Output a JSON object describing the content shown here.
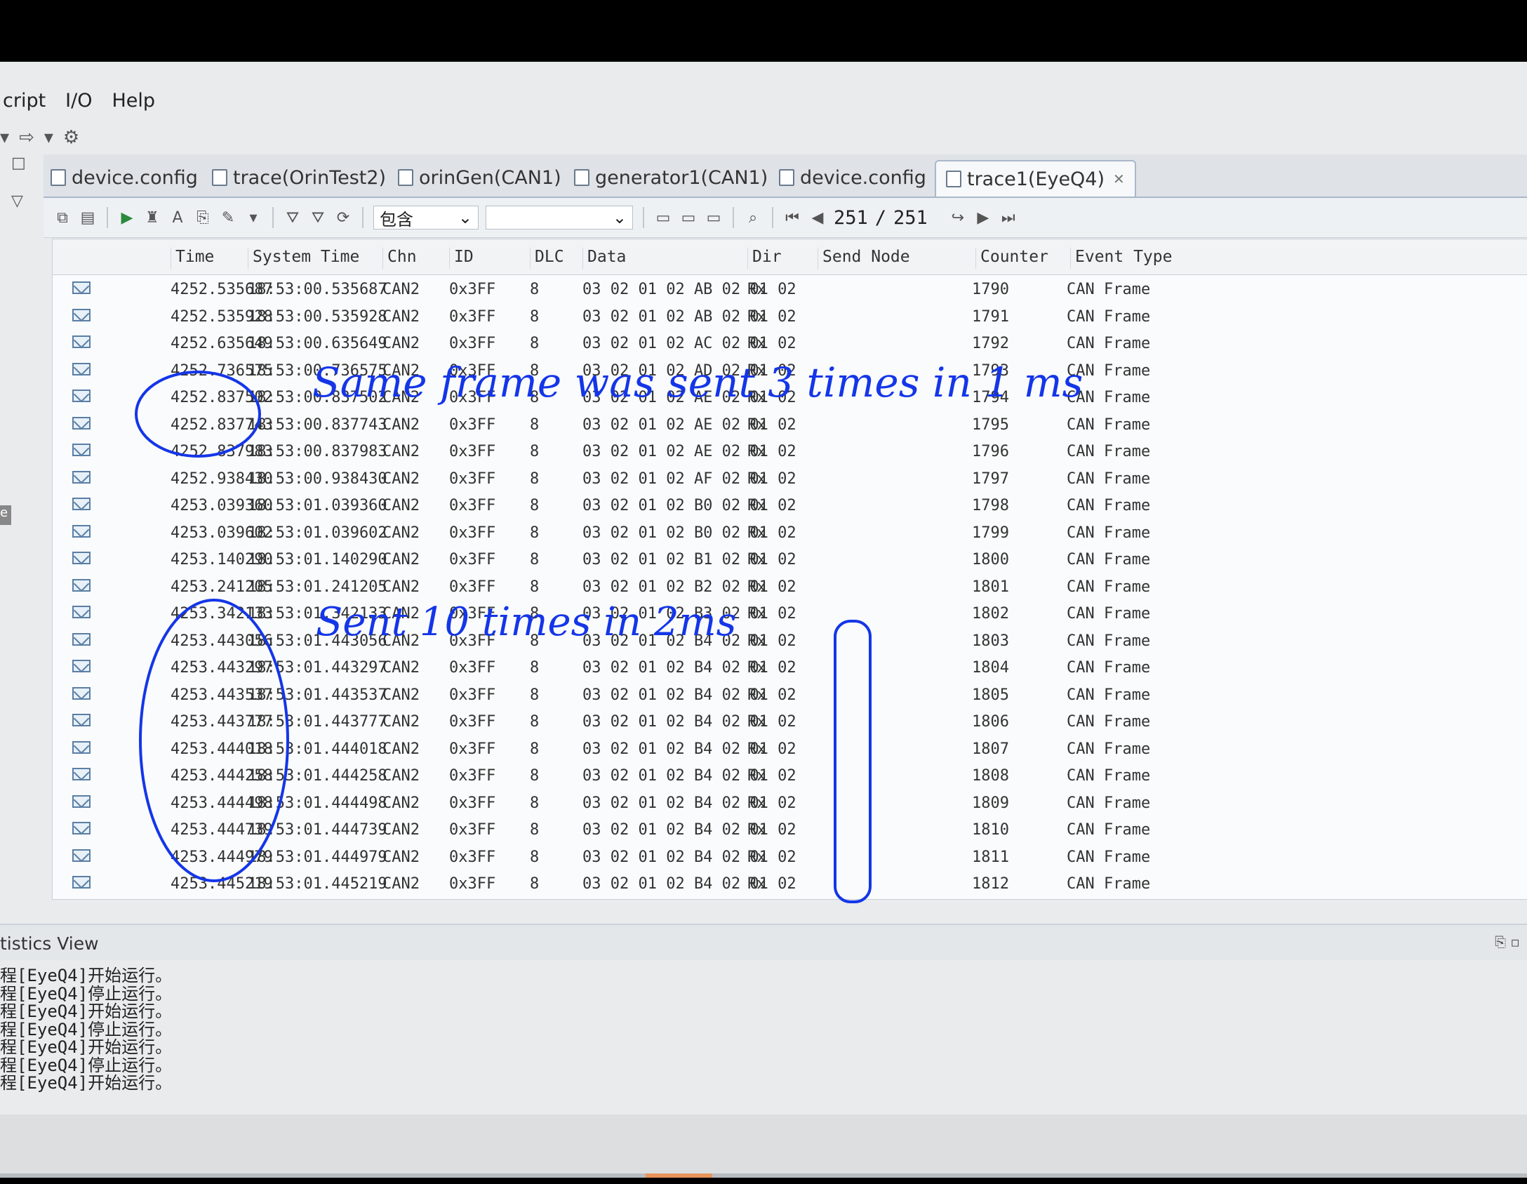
{
  "menu": {
    "items": [
      "cript",
      "I/O",
      "Help"
    ]
  },
  "tabs": [
    {
      "label": "device.config"
    },
    {
      "label": "trace(OrinTest2)"
    },
    {
      "label": "orinGen(CAN1)"
    },
    {
      "label": "generator1(CAN1)"
    },
    {
      "label": "device.config"
    },
    {
      "label": "trace1(EyeQ4)"
    }
  ],
  "toolbar": {
    "filter_mode": "包含",
    "page_current": "251",
    "page_separator": "/",
    "page_total": "251"
  },
  "columns": [
    "Time",
    "System Time",
    "Chn",
    "ID",
    "DLC",
    "Data",
    "Dir",
    "Send Node",
    "Counter",
    "Event Type"
  ],
  "rows": [
    [
      "4252.535687",
      "18:53:00.535687",
      "CAN2",
      "0x3FF",
      "8",
      "03 02 01 02 AB 02 01 02",
      "Rx",
      "",
      "1790",
      "CAN Frame"
    ],
    [
      "4252.535928",
      "18:53:00.535928",
      "CAN2",
      "0x3FF",
      "8",
      "03 02 01 02 AB 02 01 02",
      "Rx",
      "",
      "1791",
      "CAN Frame"
    ],
    [
      "4252.635649",
      "18:53:00.635649",
      "CAN2",
      "0x3FF",
      "8",
      "03 02 01 02 AC 02 01 02",
      "Rx",
      "",
      "1792",
      "CAN Frame"
    ],
    [
      "4252.736575",
      "18:53:00.736575",
      "CAN2",
      "0x3FF",
      "8",
      "03 02 01 02 AD 02 01 02",
      "Rx",
      "",
      "1793",
      "CAN Frame"
    ],
    [
      "4252.837502",
      "18:53:00.837502",
      "CAN2",
      "0x3FF",
      "8",
      "03 02 01 02 AE 02 01 02",
      "Rx",
      "",
      "1794",
      "CAN Frame"
    ],
    [
      "4252.837743",
      "18:53:00.837743",
      "CAN2",
      "0x3FF",
      "8",
      "03 02 01 02 AE 02 01 02",
      "Rx",
      "",
      "1795",
      "CAN Frame"
    ],
    [
      "4252.837983",
      "18:53:00.837983",
      "CAN2",
      "0x3FF",
      "8",
      "03 02 01 02 AE 02 01 02",
      "Rx",
      "",
      "1796",
      "CAN Frame"
    ],
    [
      "4252.938430",
      "18:53:00.938430",
      "CAN2",
      "0x3FF",
      "8",
      "03 02 01 02 AF 02 01 02",
      "Rx",
      "",
      "1797",
      "CAN Frame"
    ],
    [
      "4253.039360",
      "18:53:01.039360",
      "CAN2",
      "0x3FF",
      "8",
      "03 02 01 02 B0 02 01 02",
      "Rx",
      "",
      "1798",
      "CAN Frame"
    ],
    [
      "4253.039602",
      "18:53:01.039602",
      "CAN2",
      "0x3FF",
      "8",
      "03 02 01 02 B0 02 01 02",
      "Rx",
      "",
      "1799",
      "CAN Frame"
    ],
    [
      "4253.140290",
      "18:53:01.140290",
      "CAN2",
      "0x3FF",
      "8",
      "03 02 01 02 B1 02 01 02",
      "Rx",
      "",
      "1800",
      "CAN Frame"
    ],
    [
      "4253.241205",
      "18:53:01.241205",
      "CAN2",
      "0x3FF",
      "8",
      "03 02 01 02 B2 02 01 02",
      "Rx",
      "",
      "1801",
      "CAN Frame"
    ],
    [
      "4253.342133",
      "18:53:01.342133",
      "CAN2",
      "0x3FF",
      "8",
      "03 02 01 02 B3 02 01 02",
      "Rx",
      "",
      "1802",
      "CAN Frame"
    ],
    [
      "4253.443056",
      "18:53:01.443056",
      "CAN2",
      "0x3FF",
      "8",
      "03 02 01 02 B4 02 01 02",
      "Rx",
      "",
      "1803",
      "CAN Frame"
    ],
    [
      "4253.443297",
      "18:53:01.443297",
      "CAN2",
      "0x3FF",
      "8",
      "03 02 01 02 B4 02 01 02",
      "Rx",
      "",
      "1804",
      "CAN Frame"
    ],
    [
      "4253.443537",
      "18:53:01.443537",
      "CAN2",
      "0x3FF",
      "8",
      "03 02 01 02 B4 02 01 02",
      "Rx",
      "",
      "1805",
      "CAN Frame"
    ],
    [
      "4253.443777",
      "18:53:01.443777",
      "CAN2",
      "0x3FF",
      "8",
      "03 02 01 02 B4 02 01 02",
      "Rx",
      "",
      "1806",
      "CAN Frame"
    ],
    [
      "4253.444018",
      "18:53:01.444018",
      "CAN2",
      "0x3FF",
      "8",
      "03 02 01 02 B4 02 01 02",
      "Rx",
      "",
      "1807",
      "CAN Frame"
    ],
    [
      "4253.444258",
      "18:53:01.444258",
      "CAN2",
      "0x3FF",
      "8",
      "03 02 01 02 B4 02 01 02",
      "Rx",
      "",
      "1808",
      "CAN Frame"
    ],
    [
      "4253.444498",
      "18:53:01.444498",
      "CAN2",
      "0x3FF",
      "8",
      "03 02 01 02 B4 02 01 02",
      "Rx",
      "",
      "1809",
      "CAN Frame"
    ],
    [
      "4253.444739",
      "18:53:01.444739",
      "CAN2",
      "0x3FF",
      "8",
      "03 02 01 02 B4 02 01 02",
      "Rx",
      "",
      "1810",
      "CAN Frame"
    ],
    [
      "4253.444979",
      "18:53:01.444979",
      "CAN2",
      "0x3FF",
      "8",
      "03 02 01 02 B4 02 01 02",
      "Rx",
      "",
      "1811",
      "CAN Frame"
    ],
    [
      "4253.445219",
      "18:53:01.445219",
      "CAN2",
      "0x3FF",
      "8",
      "03 02 01 02 B4 02 01 02",
      "Rx",
      "",
      "1812",
      "CAN Frame"
    ]
  ],
  "statistics": {
    "title": "tistics View"
  },
  "log_lines": [
    "程[EyeQ4]开始运行。",
    "程[EyeQ4]停止运行。",
    "程[EyeQ4]开始运行。",
    "程[EyeQ4]停止运行。",
    "程[EyeQ4]开始运行。",
    "程[EyeQ4]停止运行。",
    "程[EyeQ4]开始运行。"
  ],
  "annotations": {
    "note1": "Same frame was sent 3 times in 1 ms",
    "note2": "Sent 10 times in 2ms",
    "ink_color": "#1436e8"
  }
}
